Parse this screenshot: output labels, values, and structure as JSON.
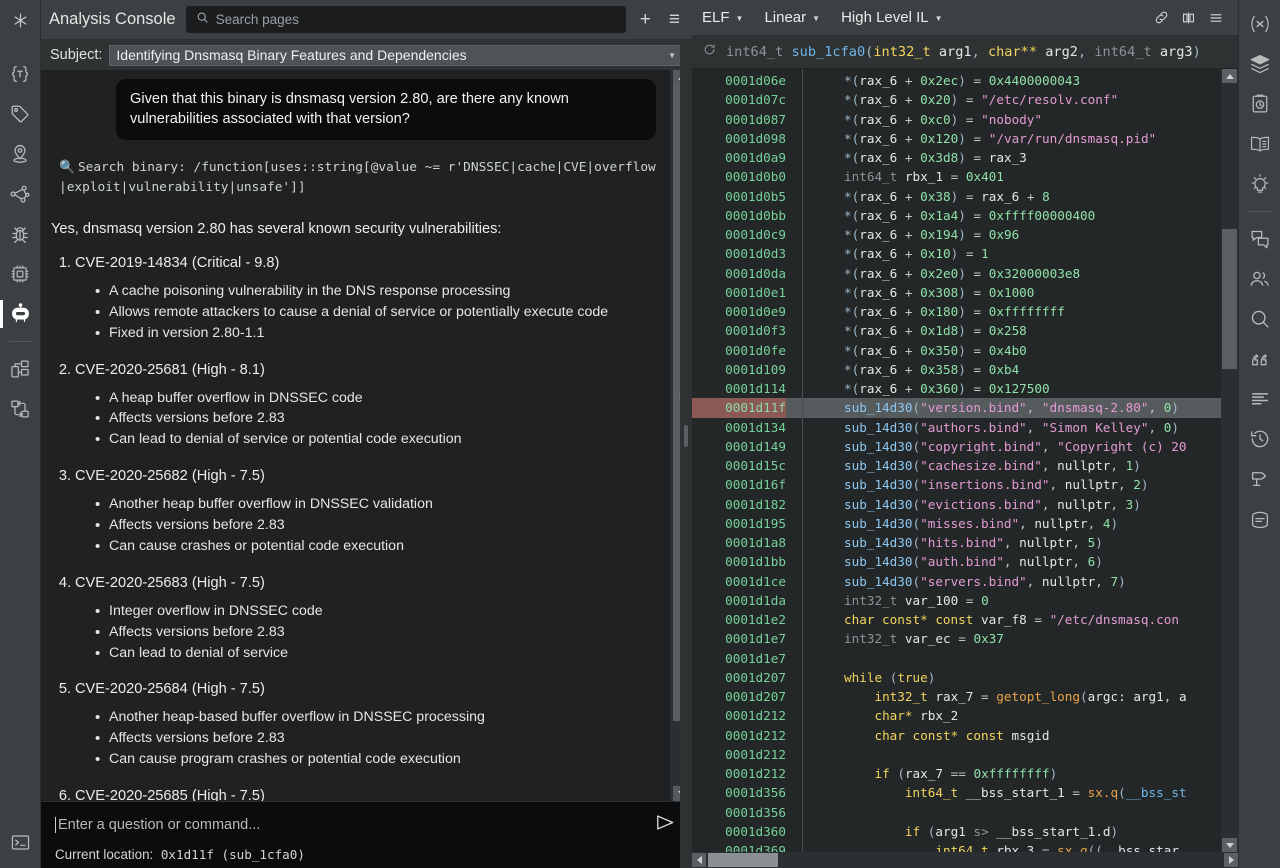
{
  "header": {
    "app_title": "Analysis Console",
    "search_placeholder": "Search pages",
    "add_label": "+",
    "menu_label": "≡",
    "logo_icon": "asterisk-logo-icon"
  },
  "subject": {
    "label": "Subject:",
    "value": "Identifying Dnsmasq Binary Features and Dependencies"
  },
  "left_rail": [
    {
      "name": "types-icon",
      "title": "{T}"
    },
    {
      "name": "tags-icon",
      "title": "Tags"
    },
    {
      "name": "location-pin-icon",
      "title": "Locations"
    },
    {
      "name": "call-graph-icon",
      "title": "Graph"
    },
    {
      "name": "bug-icon",
      "title": "Debugger"
    },
    {
      "name": "chip-icon",
      "title": "Platform"
    },
    {
      "name": "robot-icon",
      "title": "Assistant",
      "active": true
    },
    {
      "name": "components-icon",
      "title": "Components"
    },
    {
      "name": "transform-icon",
      "title": "Transforms"
    },
    {
      "name": "terminal-icon",
      "title": "Console"
    }
  ],
  "right_rail": [
    {
      "name": "variables-icon",
      "title": "(x)"
    },
    {
      "name": "layers-icon",
      "title": "Layers"
    },
    {
      "name": "clipboard-clock-icon",
      "title": "History"
    },
    {
      "name": "book-icon",
      "title": "Documentation"
    },
    {
      "name": "lightbulb-icon",
      "title": "Hints"
    },
    {
      "name": "comments-icon",
      "title": "Comments"
    },
    {
      "name": "users-icon",
      "title": "Collaborators"
    },
    {
      "name": "search-icon",
      "title": "Search"
    },
    {
      "name": "quotes-icon",
      "title": "Strings"
    },
    {
      "name": "lines-icon",
      "title": "Log"
    },
    {
      "name": "history-clock-icon",
      "title": "Undo History"
    },
    {
      "name": "flag-marker-icon",
      "title": "Bookmarks"
    },
    {
      "name": "stack-icon",
      "title": "Stack"
    }
  ],
  "chat": {
    "user_message": "Given that this binary is dnsmasq version 2.80, are there any known vulnerabilities associated with that version?",
    "tool_call": "Search binary: /function[uses::string[@value ~= r'DNSSEC|cache|CVE|overflow|exploit|vulnerability|unsafe']]",
    "tool_call_icon": "magnifier-icon",
    "answer_lead": "Yes, dnsmasq version 2.80 has several known security vulnerabilities:",
    "cves": [
      {
        "num": "1.",
        "title": "CVE-2019-14834 (Critical - 9.8)",
        "bullets": [
          "A cache poisoning vulnerability in the DNS response processing",
          "Allows remote attackers to cause a denial of service or potentially execute code",
          "Fixed in version 2.80-1.1"
        ]
      },
      {
        "num": "2.",
        "title": "CVE-2020-25681 (High - 8.1)",
        "bullets": [
          "A heap buffer overflow in DNSSEC code",
          "Affects versions before 2.83",
          "Can lead to denial of service or potential code execution"
        ]
      },
      {
        "num": "3.",
        "title": "CVE-2020-25682 (High - 7.5)",
        "bullets": [
          "Another heap buffer overflow in DNSSEC validation",
          "Affects versions before 2.83",
          "Can cause crashes or potential code execution"
        ]
      },
      {
        "num": "4.",
        "title": "CVE-2020-25683 (High - 7.5)",
        "bullets": [
          "Integer overflow in DNSSEC code",
          "Affects versions before 2.83",
          "Can lead to denial of service"
        ]
      },
      {
        "num": "5.",
        "title": "CVE-2020-25684 (High - 7.5)",
        "bullets": [
          "Another heap-based buffer overflow in DNSSEC processing",
          "Affects versions before 2.83",
          "Can cause program crashes or potential code execution"
        ]
      },
      {
        "num": "6.",
        "title": "CVE-2020-25685 (High - 7.5)",
        "bullets": []
      }
    ]
  },
  "composer": {
    "placeholder": "Enter a question or command...",
    "value": "",
    "send_icon": "send-icon",
    "status_label": "Current location:",
    "status_value": "0x1d11f (sub_1cfa0)"
  },
  "code_toolbar": {
    "view_type": "ELF",
    "view_mode": "Linear",
    "il_level": "High Level IL",
    "link_icon": "link-icon",
    "split_icon": "split-pane-icon",
    "menu_icon": "hamburger-menu-icon"
  },
  "function_signature": {
    "reload_icon": "reload-icon",
    "return_type": "int64_t",
    "name": "sub_1cfa0",
    "params": "(int32_t arg1, char** arg2, int64_t arg3)"
  },
  "code_lines": [
    {
      "addr": "0001d06e",
      "text": "*(rax_6 + 0x2ec) = 0x4400000043"
    },
    {
      "addr": "0001d07c",
      "text": "*(rax_6 + 0x20) = \"/etc/resolv.conf\""
    },
    {
      "addr": "0001d087",
      "text": "*(rax_6 + 0xc0) = \"nobody\""
    },
    {
      "addr": "0001d098",
      "text": "*(rax_6 + 0x120) = \"/var/run/dnsmasq.pid\""
    },
    {
      "addr": "0001d0a9",
      "text": "*(rax_6 + 0x3d8) = rax_3"
    },
    {
      "addr": "0001d0b0",
      "text": "int64_t rbx_1 = 0x401"
    },
    {
      "addr": "0001d0b5",
      "text": "*(rax_6 + 0x38) = rax_6 + 8"
    },
    {
      "addr": "0001d0bb",
      "text": "*(rax_6 + 0x1a4) = 0xffff00000400"
    },
    {
      "addr": "0001d0c9",
      "text": "*(rax_6 + 0x194) = 0x96"
    },
    {
      "addr": "0001d0d3",
      "text": "*(rax_6 + 0x10) = 1"
    },
    {
      "addr": "0001d0da",
      "text": "*(rax_6 + 0x2e0) = 0x32000003e8"
    },
    {
      "addr": "0001d0e1",
      "text": "*(rax_6 + 0x308) = 0x1000"
    },
    {
      "addr": "0001d0e9",
      "text": "*(rax_6 + 0x180) = 0xffffffff"
    },
    {
      "addr": "0001d0f3",
      "text": "*(rax_6 + 0x1d8) = 0x258"
    },
    {
      "addr": "0001d0fe",
      "text": "*(rax_6 + 0x350) = 0x4b0"
    },
    {
      "addr": "0001d109",
      "text": "*(rax_6 + 0x358) = 0xb4"
    },
    {
      "addr": "0001d114",
      "text": "*(rax_6 + 0x360) = 0x127500"
    },
    {
      "addr": "0001d11f",
      "text": "sub_14d30(\"version.bind\", \"dnsmasq-2.80\", 0)",
      "highlighted": true
    },
    {
      "addr": "0001d134",
      "text": "sub_14d30(\"authors.bind\", \"Simon Kelley\", 0)"
    },
    {
      "addr": "0001d149",
      "text": "sub_14d30(\"copyright.bind\", \"Copyright (c) 20"
    },
    {
      "addr": "0001d15c",
      "text": "sub_14d30(\"cachesize.bind\", nullptr, 1)"
    },
    {
      "addr": "0001d16f",
      "text": "sub_14d30(\"insertions.bind\", nullptr, 2)"
    },
    {
      "addr": "0001d182",
      "text": "sub_14d30(\"evictions.bind\", nullptr, 3)"
    },
    {
      "addr": "0001d195",
      "text": "sub_14d30(\"misses.bind\", nullptr, 4)"
    },
    {
      "addr": "0001d1a8",
      "text": "sub_14d30(\"hits.bind\", nullptr, 5)"
    },
    {
      "addr": "0001d1bb",
      "text": "sub_14d30(\"auth.bind\", nullptr, 6)"
    },
    {
      "addr": "0001d1ce",
      "text": "sub_14d30(\"servers.bind\", nullptr, 7)"
    },
    {
      "addr": "0001d1da",
      "text": "int32_t var_100 = 0"
    },
    {
      "addr": "0001d1e2",
      "text": "char const* const var_f8 = \"/etc/dnsmasq.con"
    },
    {
      "addr": "0001d1e7",
      "text": "int32_t var_ec = 0x37"
    },
    {
      "addr": "0001d1e7",
      "text": ""
    },
    {
      "addr": "0001d207",
      "text": "while (true)"
    },
    {
      "addr": "0001d207",
      "text": "    int32_t rax_7 = getopt_long(argc: arg1, a"
    },
    {
      "addr": "0001d212",
      "text": "    char* rbx_2"
    },
    {
      "addr": "0001d212",
      "text": "    char const* const msgid"
    },
    {
      "addr": "0001d212",
      "text": ""
    },
    {
      "addr": "0001d212",
      "text": "    if (rax_7 == 0xffffffff)"
    },
    {
      "addr": "0001d356",
      "text": "        int64_t __bss_start_1 = sx.q(__bss_st"
    },
    {
      "addr": "0001d356",
      "text": ""
    },
    {
      "addr": "0001d360",
      "text": "        if (arg1 s> __bss_start_1.d)"
    },
    {
      "addr": "0001d369",
      "text": "            int64_t rbx_3 = sx.q((__bss_star"
    }
  ],
  "colors": {
    "accent_highlight": "#565b5d",
    "addr_highlight": "#8b5a55",
    "address_green": "#77d19a",
    "string_pink": "#e49bd3",
    "number_green": "#90e0a8",
    "keyword_yellow": "#f2d45c",
    "function_orange": "#e8a44c",
    "sub_blue": "#8ec8f0",
    "type_gray": "#8e9496",
    "panel_bg": "#1f2122",
    "code_bg": "#232728",
    "chrome_bg": "#3b4042"
  }
}
